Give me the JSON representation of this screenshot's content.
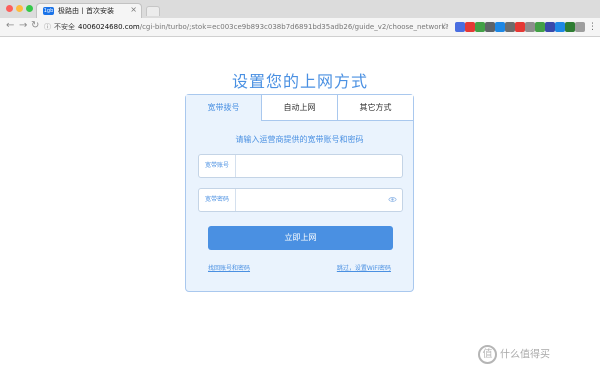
{
  "browser": {
    "tab": {
      "favicon_text": "1gb",
      "title": "极路由丨首次安装",
      "close": "×"
    },
    "address": {
      "info": "ⓘ",
      "security": "不安全",
      "host": "4006024680.com",
      "path": "/cgi-bin/turbo/;stok=ec003ce9b893c038b7d6891bd35adb26/guide_v2/choose_network?a..."
    },
    "nav": {
      "back": "←",
      "forward": "→",
      "reload": "↻"
    },
    "star": "☆",
    "menu": "⋮",
    "extensions": [
      {
        "name": "ext-1",
        "color": "#4a6ee0"
      },
      {
        "name": "ext-2",
        "color": "#e53935"
      },
      {
        "name": "ext-3",
        "color": "#43a047"
      },
      {
        "name": "ext-4",
        "color": "#5f6368"
      },
      {
        "name": "ext-5",
        "color": "#1e88e5"
      },
      {
        "name": "ext-6",
        "color": "#6d6d6d"
      },
      {
        "name": "ext-7",
        "color": "#e53935"
      },
      {
        "name": "ext-8",
        "color": "#8e8e8e"
      },
      {
        "name": "ext-9",
        "color": "#43a047"
      },
      {
        "name": "ext-10",
        "color": "#3949ab"
      },
      {
        "name": "ext-11",
        "color": "#1e88e5"
      },
      {
        "name": "ext-12",
        "color": "#2e7d32"
      },
      {
        "name": "ext-13",
        "color": "#9e9e9e"
      }
    ]
  },
  "page": {
    "title": "设置您的上网方式",
    "tabs": [
      {
        "label": "宽带拨号",
        "active": true
      },
      {
        "label": "自动上网",
        "active": false
      },
      {
        "label": "其它方式",
        "active": false
      }
    ],
    "instruction": "请输入运营商提供的宽带账号和密码",
    "account_label": "宽带账号",
    "account_value": "",
    "password_label": "宽带密码",
    "password_value": "",
    "submit_label": "立即上网",
    "link_recover": "找回账号和密码",
    "link_skip": "跳过，设置WiFi密码"
  },
  "watermark": {
    "icon": "值",
    "text": "什么值得买"
  },
  "colors": {
    "accent": "#4a90e2",
    "panel": "#eaf3fd",
    "border": "#a9c8ee"
  }
}
